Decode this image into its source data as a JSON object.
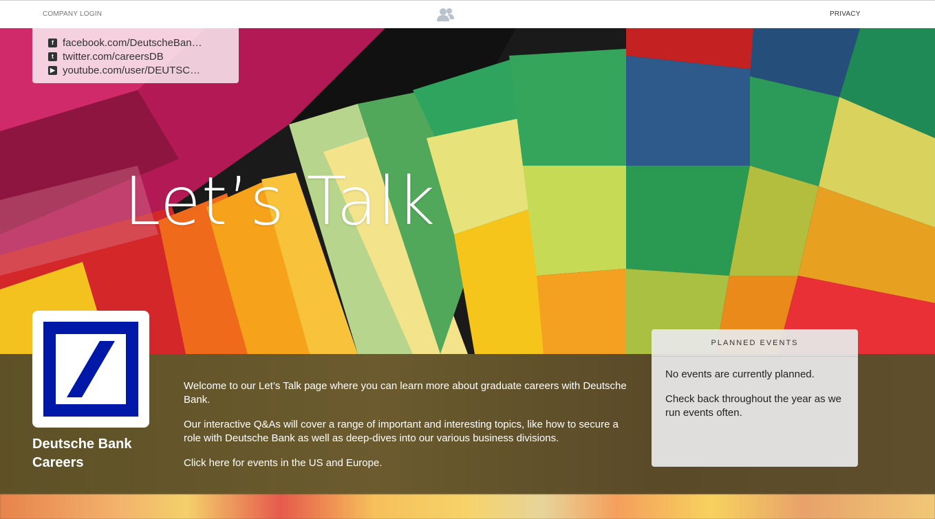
{
  "topbar": {
    "login_label": "COMPANY LOGIN",
    "privacy_label": "PRIVACY",
    "center_icon": "users-icon"
  },
  "social": {
    "items": [
      {
        "icon": "facebook-icon",
        "label": "facebook.com/DeutscheBan…"
      },
      {
        "icon": "twitter-icon",
        "label": "twitter.com/careersDB"
      },
      {
        "icon": "youtube-icon",
        "label": "youtube.com/user/DEUTSC…"
      }
    ]
  },
  "hero": {
    "title": "Let’s Talk"
  },
  "company": {
    "name": "Deutsche Bank Careers",
    "logo": "deutsche-bank-logo",
    "brand_color": "#0018a8"
  },
  "intro": {
    "para1": "Welcome to our Let’s Talk page where you can learn more about graduate careers with Deutsche Bank.",
    "para2": "Our interactive Q&As will cover a range of important and interesting topics, like how to secure a role with Deutsche Bank as well as deep-dives into our various business divisions.",
    "link": "Click here for events in the US and Europe."
  },
  "events": {
    "heading": "PLANNED EVENTS",
    "line1": "No events are currently planned.",
    "line2": "Check back throughout the year as we run events often."
  }
}
